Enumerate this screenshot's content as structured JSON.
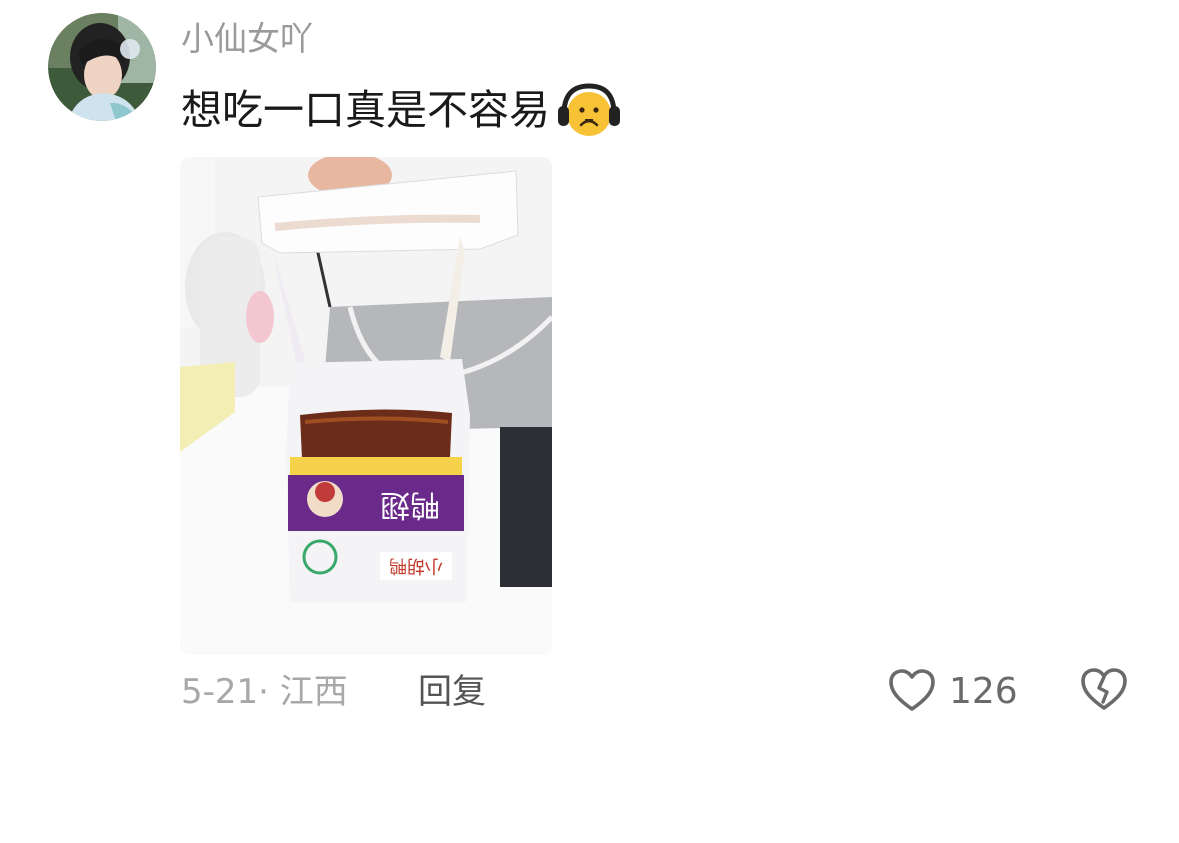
{
  "comment": {
    "username": "小仙女吖",
    "text": "想吃一口真是不容易",
    "emoji": "headphones-frowning-face-emoji",
    "date_location": "5-21· 江西",
    "reply_label": "回复",
    "like_count": "126"
  },
  "photo": {
    "bag_title": "鸭翅",
    "brand": "小胡鸭"
  },
  "colors": {
    "username": "#9a9a9a",
    "text": "#1a1a1a",
    "meta": "#a8a8a8",
    "reply": "#555555",
    "icon": "#6a6a6a",
    "emoji_face": "#f7c236",
    "bag_purple": "#6a2a8a"
  }
}
